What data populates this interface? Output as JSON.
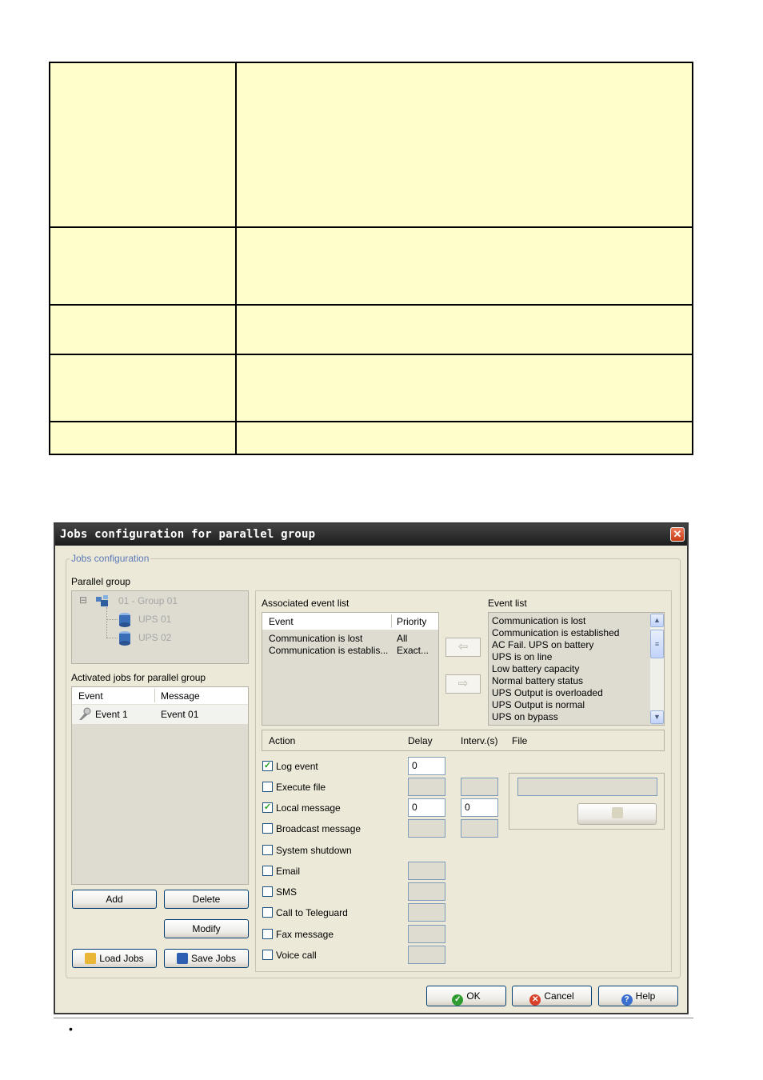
{
  "dialog": {
    "title": "Jobs configuration for parallel group",
    "close_glyph": "✕",
    "group_label": "Jobs configuration",
    "parallel_group": {
      "label": "Parallel group",
      "root": "01 - Group 01",
      "children": [
        "UPS 01",
        "UPS 02"
      ],
      "collapse_glyph": "⊟"
    },
    "activated_jobs": {
      "label": "Activated jobs for parallel group",
      "columns": [
        "Event",
        "Message"
      ],
      "rows": [
        {
          "event": "Event 1",
          "message": "Event 01"
        }
      ]
    },
    "associated": {
      "label": "Associated event list",
      "columns": [
        "Event",
        "Priority"
      ],
      "rows": [
        {
          "event": "Communication is lost",
          "priority": "All"
        },
        {
          "event": "Communication is establis...",
          "priority": "Exact..."
        }
      ]
    },
    "event_list": {
      "label": "Event list",
      "items": [
        "Communication is lost",
        "Communication is established",
        "AC Fail. UPS on battery",
        "UPS is on line",
        "Low battery capacity",
        "Normal battery status",
        "UPS Output is overloaded",
        "UPS Output is normal",
        "UPS on bypass"
      ]
    },
    "arrows": {
      "left": "⇦",
      "right": "⇨"
    },
    "actions": {
      "columns": {
        "action": "Action",
        "delay": "Delay",
        "interval": "Interv.(s)",
        "file": "File"
      },
      "items": [
        {
          "label": "Log event",
          "checked": true,
          "delay": "0"
        },
        {
          "label": "Execute file",
          "checked": false,
          "delay": "",
          "interval": ""
        },
        {
          "label": "Local message",
          "checked": true,
          "delay": "0",
          "interval": "0"
        },
        {
          "label": "Broadcast message",
          "checked": false,
          "delay": "",
          "interval": ""
        },
        {
          "label": "System shutdown",
          "checked": false
        },
        {
          "label": "Email",
          "checked": false,
          "delay": ""
        },
        {
          "label": "SMS",
          "checked": false,
          "delay": ""
        },
        {
          "label": "Call to Teleguard",
          "checked": false,
          "delay": ""
        },
        {
          "label": "Fax message",
          "checked": false,
          "delay": ""
        },
        {
          "label": "Voice call",
          "checked": false,
          "delay": ""
        }
      ],
      "check_glyph": "✓"
    },
    "buttons": {
      "add": "Add",
      "delete": "Delete",
      "modify": "Modify",
      "load_jobs": "Load Jobs",
      "save_jobs": "Save Jobs",
      "ok": "OK",
      "cancel": "Cancel",
      "help": "Help"
    },
    "colors": {
      "title_bar": "#2b2b2b",
      "group_label": "#5a78b8",
      "table_fill": "#ffffcc"
    }
  },
  "bullet": "•"
}
